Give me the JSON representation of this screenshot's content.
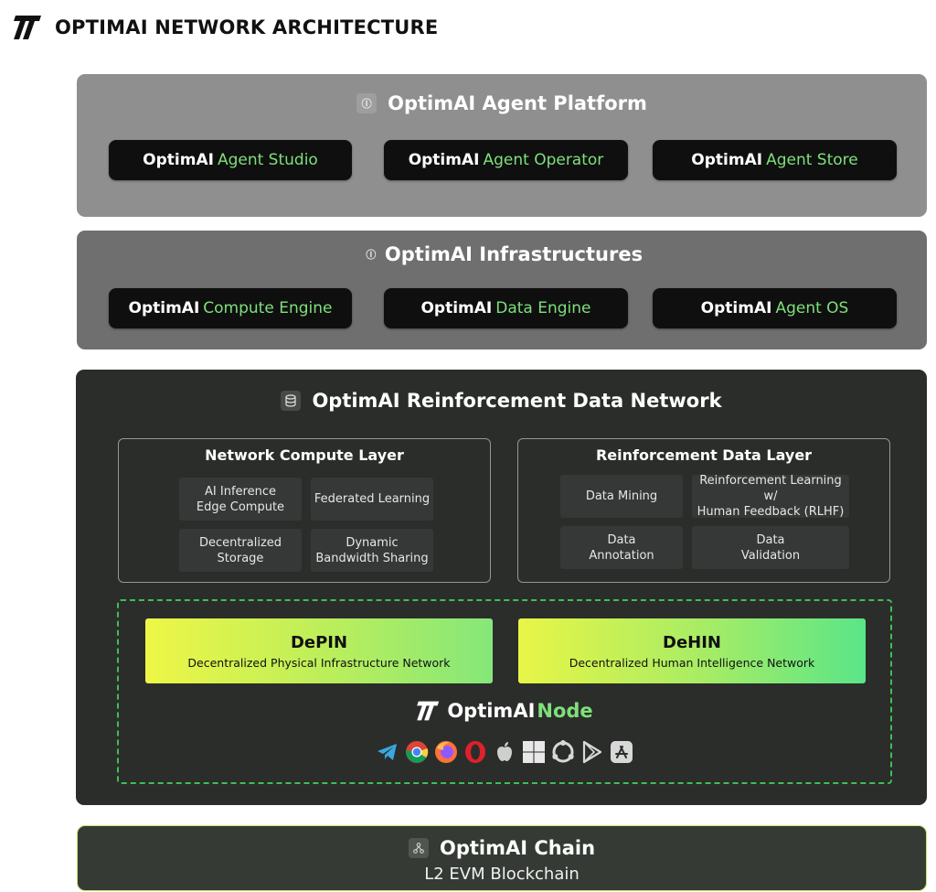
{
  "header": {
    "title": "OPTIMAI NETWORK ARCHITECTURE",
    "logo_icon": "optimai-logo-icon"
  },
  "platform": {
    "title": "OptimAI Agent Platform",
    "pills": [
      {
        "brand": "OptimAI",
        "product": "Agent Studio"
      },
      {
        "brand": "OptimAI",
        "product": "Agent Operator"
      },
      {
        "brand": "OptimAI",
        "product": "Agent Store"
      }
    ]
  },
  "infra": {
    "title": "OptimAI Infrastructures",
    "pills": [
      {
        "brand": "OptimAI",
        "product": "Compute Engine"
      },
      {
        "brand": "OptimAI",
        "product": "Data Engine"
      },
      {
        "brand": "OptimAI",
        "product": "Agent OS"
      }
    ]
  },
  "rdn": {
    "title": "OptimAI Reinforcement Data Network",
    "compute_layer": {
      "title": "Network Compute Layer",
      "cells": [
        "AI Inference\nEdge Compute",
        "Federated Learning",
        "Decentralized\nStorage",
        "Dynamic\nBandwidth Sharing"
      ]
    },
    "data_layer": {
      "title": "Reinforcement Data Layer",
      "cells": [
        "Data Mining",
        "Reinforcement Learning w/\nHuman Feedback (RLHF)",
        "Data\nAnnotation",
        "Data\nValidation"
      ]
    },
    "depin": {
      "title": "DePIN",
      "subtitle": "Decentralized Physical Infrastructure Network"
    },
    "dehin": {
      "title": "DeHIN",
      "subtitle": "Decentralized Human Intelligence Network"
    },
    "node": {
      "brand": "OptimAI",
      "product": "Node"
    },
    "app_icons": [
      "telegram-icon",
      "chrome-icon",
      "firefox-icon",
      "opera-icon",
      "apple-icon",
      "windows-icon",
      "ubuntu-icon",
      "google-play-icon",
      "app-store-icon"
    ]
  },
  "chain": {
    "title": "OptimAI Chain",
    "subtitle": "L2 EVM Blockchain"
  },
  "colors": {
    "accent_green": "#7ee07a",
    "dashed_border": "#3fbf52",
    "chain_border": "#c6e36b"
  }
}
